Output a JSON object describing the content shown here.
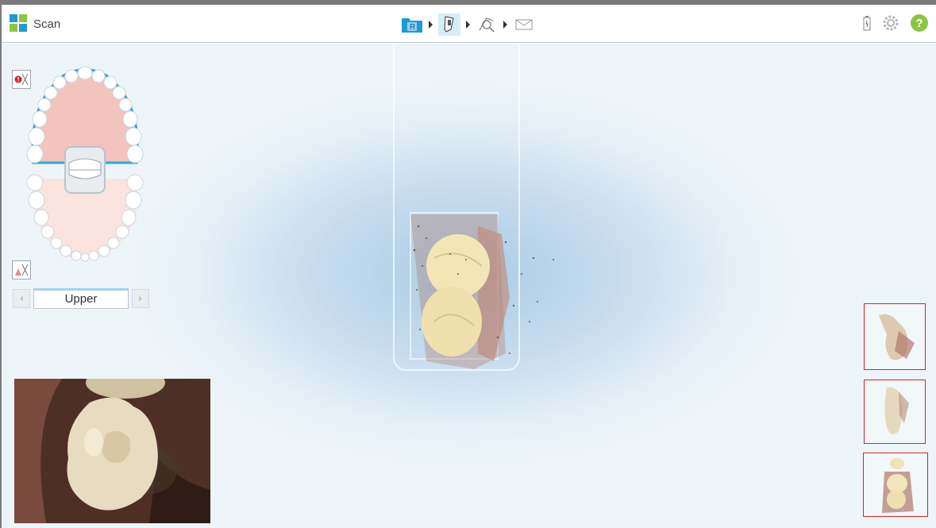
{
  "app": {
    "title": "Scan"
  },
  "workflow": {
    "steps": [
      {
        "name": "rx",
        "icon": "rx-folder-icon",
        "label": "R"
      },
      {
        "name": "scan",
        "icon": "scanner-wand-icon",
        "active": true
      },
      {
        "name": "view",
        "icon": "view-tooth-icon"
      },
      {
        "name": "send",
        "icon": "envelope-icon"
      }
    ]
  },
  "toolbar_right": {
    "help_label": "?"
  },
  "arch": {
    "current": "Upper"
  },
  "colors": {
    "accent": "#1e9ad6",
    "help": "#8cc63f",
    "thumb_border": "#d6232a"
  }
}
